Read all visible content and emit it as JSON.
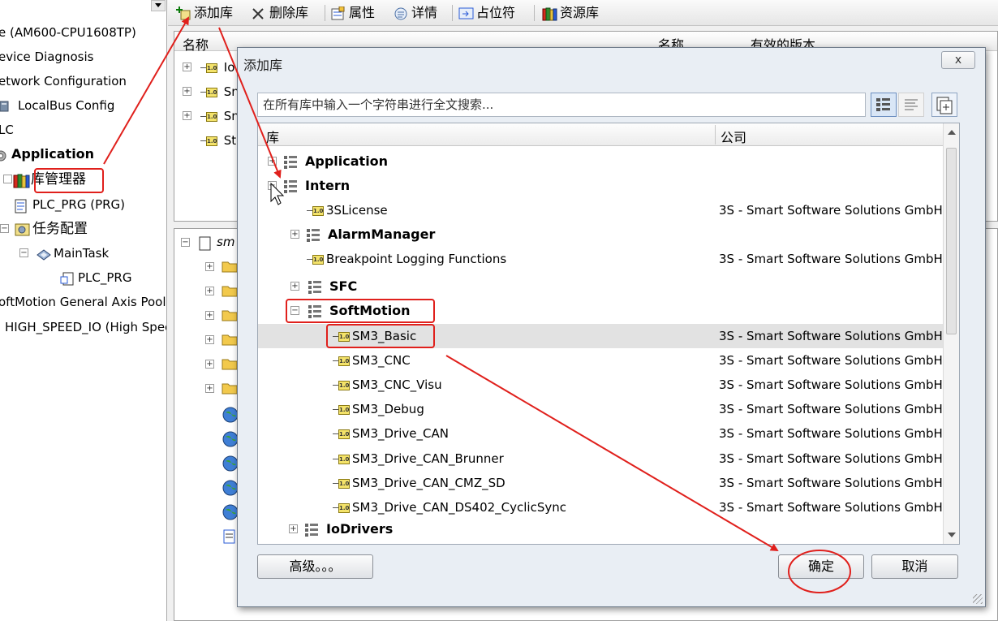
{
  "tree": {
    "items": [
      {
        "label": "e (AM600-CPU1608TP)"
      },
      {
        "label": "evice Diagnosis"
      },
      {
        "label": "etwork Configuration"
      },
      {
        "label": "LocalBus Config"
      },
      {
        "label": "LC"
      },
      {
        "label": "Application"
      },
      {
        "label": "库管理器"
      },
      {
        "label": "PLC_PRG (PRG)"
      },
      {
        "label": "任务配置"
      },
      {
        "label": "MainTask"
      },
      {
        "label": "PLC_PRG"
      },
      {
        "label": "oftMotion General Axis Pool"
      },
      {
        "label": "HIGH_SPEED_IO (High Speed"
      }
    ]
  },
  "toolbar": {
    "add_library": "添加库",
    "delete_library": "删除库",
    "properties": "属性",
    "details": "详情",
    "placeholder": "占位符",
    "repository": "资源库"
  },
  "library_panel": {
    "col_name": "名称",
    "col_name2": "名称",
    "col_effective_version": "有效的版本",
    "row_partials": [
      "Io",
      "Sn",
      "Sn",
      "St"
    ],
    "lower_partial": "sm"
  },
  "dialog": {
    "title": "添加库",
    "close": "x",
    "search_placeholder": "在所有库中输入一个字符串进行全文搜索...",
    "col_library": "库",
    "col_company": "公司",
    "rows": [
      {
        "name": "Application",
        "company": "",
        "type": "group",
        "expander": "+"
      },
      {
        "name": "Intern",
        "company": "",
        "type": "group",
        "expander": "−"
      },
      {
        "name": "3SLicense",
        "company": "3S - Smart Software Solutions GmbH",
        "type": "lib"
      },
      {
        "name": "AlarmManager",
        "company": "",
        "type": "group",
        "expander": "+"
      },
      {
        "name": "Breakpoint Logging Functions",
        "company": "3S - Smart Software Solutions GmbH",
        "type": "lib"
      },
      {
        "name": "SFC",
        "company": "",
        "type": "group",
        "expander": "+"
      },
      {
        "name": "SoftMotion",
        "company": "",
        "type": "group",
        "expander": "−"
      },
      {
        "name": "SM3_Basic",
        "company": "3S - Smart Software Solutions GmbH",
        "type": "lib"
      },
      {
        "name": "SM3_CNC",
        "company": "3S - Smart Software Solutions GmbH",
        "type": "lib"
      },
      {
        "name": "SM3_CNC_Visu",
        "company": "3S - Smart Software Solutions GmbH",
        "type": "lib"
      },
      {
        "name": "SM3_Debug",
        "company": "3S - Smart Software Solutions GmbH",
        "type": "lib"
      },
      {
        "name": "SM3_Drive_CAN",
        "company": "3S - Smart Software Solutions GmbH",
        "type": "lib"
      },
      {
        "name": "SM3_Drive_CAN_Brunner",
        "company": "3S - Smart Software Solutions GmbH",
        "type": "lib"
      },
      {
        "name": "SM3_Drive_CAN_CMZ_SD",
        "company": "3S - Smart Software Solutions GmbH",
        "type": "lib"
      },
      {
        "name": "SM3_Drive_CAN_DS402_CyclicSync",
        "company": "3S - Smart Software Solutions GmbH",
        "type": "lib"
      },
      {
        "name": "IoDrivers",
        "company": "",
        "type": "group",
        "expander": "+"
      }
    ],
    "advanced": "高级。。。",
    "ok": "确定",
    "cancel": "取消"
  },
  "colors": {
    "annotation_red": "#e0201c",
    "selection_gray": "#e2e2e2",
    "library_icon_yellow": "#f4e36a"
  },
  "library_icon_text": "1.0"
}
